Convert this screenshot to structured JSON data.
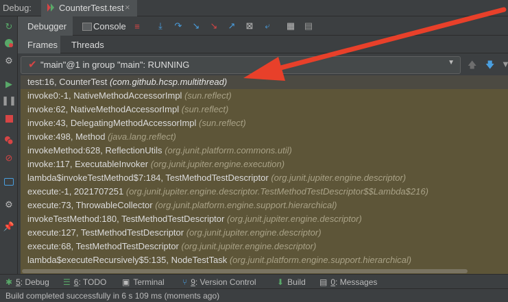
{
  "title_bar": {
    "debug_label": "Debug:",
    "run_tab_label": "CounterTest.test",
    "close_glyph": "×"
  },
  "debug_toolbar": {
    "debugger_tab": "Debugger",
    "console_tab": "Console",
    "icons": [
      "restore-layout-icon",
      "show-execution-point-icon",
      "step-over-icon",
      "step-into-icon",
      "force-step-into-icon",
      "step-out-icon",
      "drop-frame-icon",
      "run-to-cursor-icon",
      "evaluate-expression-icon",
      "trace-icon"
    ]
  },
  "sub_tabs": {
    "frames": "Frames",
    "threads": "Threads"
  },
  "thread_selector": {
    "value": "\"main\"@1 in group \"main\": RUNNING",
    "status_color": "#d64545"
  },
  "frames": [
    {
      "method": "test:16, CounterTest",
      "package": "(com.github.hcsp.multithread)"
    },
    {
      "method": "invoke0:-1, NativeMethodAccessorImpl",
      "package": "(sun.reflect)"
    },
    {
      "method": "invoke:62, NativeMethodAccessorImpl",
      "package": "(sun.reflect)"
    },
    {
      "method": "invoke:43, DelegatingMethodAccessorImpl",
      "package": "(sun.reflect)"
    },
    {
      "method": "invoke:498, Method",
      "package": "(java.lang.reflect)"
    },
    {
      "method": "invokeMethod:628, ReflectionUtils",
      "package": "(org.junit.platform.commons.util)"
    },
    {
      "method": "invoke:117, ExecutableInvoker",
      "package": "(org.junit.jupiter.engine.execution)"
    },
    {
      "method": "lambda$invokeTestMethod$7:184, TestMethodTestDescriptor",
      "package": "(org.junit.jupiter.engine.descriptor)"
    },
    {
      "method": "execute:-1, 2021707251",
      "package": "(org.junit.jupiter.engine.descriptor.TestMethodTestDescriptor$$Lambda$216)"
    },
    {
      "method": "execute:73, ThrowableCollector",
      "package": "(org.junit.platform.engine.support.hierarchical)"
    },
    {
      "method": "invokeTestMethod:180, TestMethodTestDescriptor",
      "package": "(org.junit.jupiter.engine.descriptor)"
    },
    {
      "method": "execute:127, TestMethodTestDescriptor",
      "package": "(org.junit.jupiter.engine.descriptor)"
    },
    {
      "method": "execute:68, TestMethodTestDescriptor",
      "package": "(org.junit.jupiter.engine.descriptor)"
    },
    {
      "method": "lambda$executeRecursively$5:135, NodeTestTask",
      "package": "(org.junit.platform.engine.support.hierarchical)"
    }
  ],
  "tool_windows": [
    {
      "key": "5",
      "label": ": Debug",
      "icon": "bug-icon"
    },
    {
      "key": "6",
      "label": ": TODO",
      "icon": "todo-icon"
    },
    {
      "key": "",
      "label": "Terminal",
      "icon": "terminal-icon"
    },
    {
      "key": "9",
      "label": ": Version Control",
      "icon": "version-control-icon"
    },
    {
      "key": "",
      "label": "Build",
      "icon": "build-icon"
    },
    {
      "key": "0",
      "label": ": Messages",
      "icon": "messages-icon"
    }
  ],
  "status_bar": {
    "text": "Build completed successfully in 6 s 109 ms (moments ago)"
  },
  "colors": {
    "accent": "#4a88c7",
    "annotation_arrow": "#e8402a",
    "frames_bg": "#5d5538"
  }
}
